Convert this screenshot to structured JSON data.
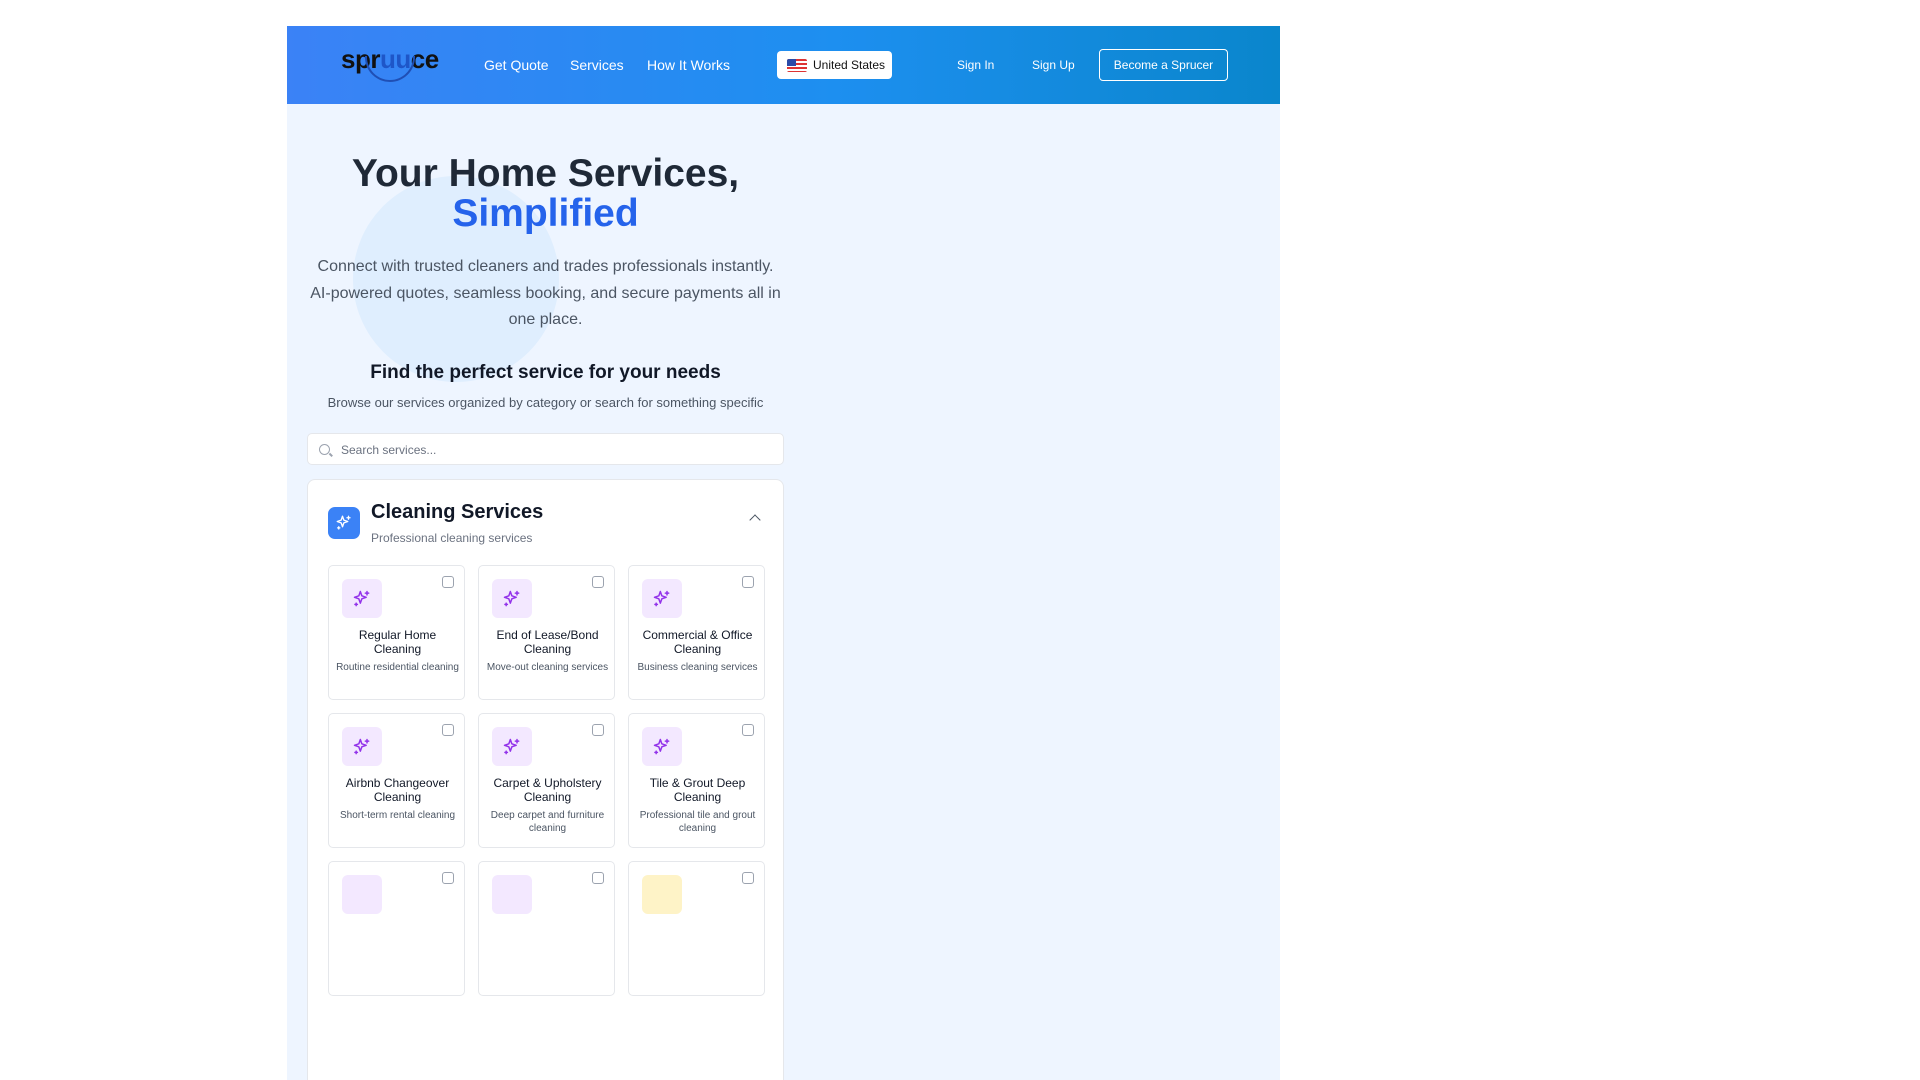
{
  "header": {
    "logo": {
      "left": "spr",
      "mid": "uu",
      "right": "ce"
    },
    "nav": [
      "Get Quote",
      "Services",
      "How It Works"
    ],
    "country": "United States",
    "sign_in": "Sign In",
    "sign_up": "Sign Up",
    "become": "Become a Sprucer"
  },
  "hero": {
    "title_line1": "Your Home Services,",
    "title_line2": "Simplified",
    "subtitle": "Connect with trusted cleaners and trades professionals instantly. AI-powered quotes, seamless booking, and secure payments all in one place."
  },
  "find": {
    "title": "Find the perfect service for your needs",
    "subtitle": "Browse our services organized by category or search for something specific"
  },
  "search": {
    "placeholder": "Search services...",
    "value": ""
  },
  "category": {
    "title": "Cleaning Services",
    "subtitle": "Professional cleaning services",
    "icon": "sparkles-icon",
    "accent": "#3b82f6",
    "cards": [
      {
        "title": "Regular Home Cleaning",
        "desc": "Routine residential cleaning"
      },
      {
        "title": "End of Lease/Bond Cleaning",
        "desc": "Move-out cleaning services"
      },
      {
        "title": "Commercial & Office Cleaning",
        "desc": "Business cleaning services"
      },
      {
        "title": "Airbnb Changeover Cleaning",
        "desc": "Short-term rental cleaning"
      },
      {
        "title": "Carpet & Upholstery Cleaning",
        "desc": "Deep carpet and furniture cleaning"
      },
      {
        "title": "Tile & Grout Deep Cleaning",
        "desc": "Professional tile and grout cleaning"
      },
      {
        "title": "",
        "desc": ""
      },
      {
        "title": "",
        "desc": ""
      },
      {
        "title": "",
        "desc": ""
      }
    ]
  }
}
